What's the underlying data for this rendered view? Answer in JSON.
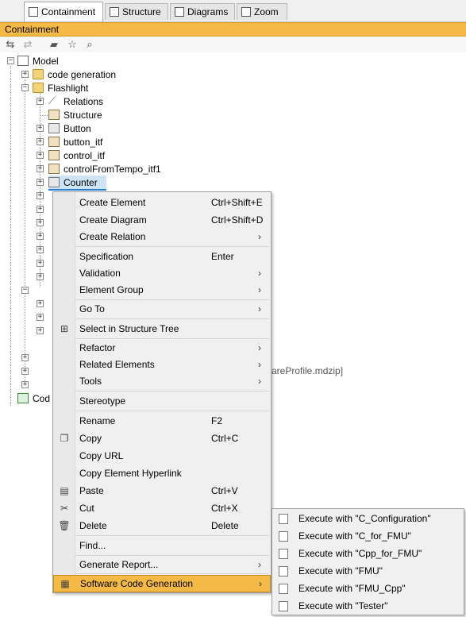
{
  "tabs": [
    {
      "label": "Containment",
      "icon": "containment-icon",
      "active": true
    },
    {
      "label": "Structure",
      "icon": "structure-icon",
      "active": false
    },
    {
      "label": "Diagrams",
      "icon": "diagrams-icon",
      "active": false
    },
    {
      "label": "Zoom",
      "icon": "zoom-icon",
      "active": false
    }
  ],
  "panel": {
    "title": "Containment"
  },
  "toolbar": {
    "icons": [
      "collapse-all-icon",
      "expand-icon",
      "open-folder-icon",
      "star-icon",
      "search-icon"
    ]
  },
  "tree": {
    "model": "Model",
    "code_generation": "code generation",
    "flashlight": "Flashlight",
    "relations": "Relations",
    "structure": "Structure",
    "button": "Button",
    "button_itf": "button_itf",
    "control_itf": "control_itf",
    "control_from_tempo": "controlFromTempo_itf1",
    "counter": "Counter",
    "profile_suffix": "areProfile.mdzip]",
    "code_partial": "Cod"
  },
  "context_menu": {
    "items": [
      {
        "label": "Create Element",
        "shortcut": "Ctrl+Shift+E"
      },
      {
        "label": "Create Diagram",
        "shortcut": "Ctrl+Shift+D"
      },
      {
        "label": "Create Relation",
        "submenu": true
      },
      {
        "label": "Specification",
        "shortcut": "Enter"
      },
      {
        "label": "Validation",
        "submenu": true
      },
      {
        "label": "Element Group",
        "submenu": true
      },
      {
        "label": "Go To",
        "submenu": true
      },
      {
        "label": "Select in Structure Tree",
        "icon": "structure-tree-icon"
      },
      {
        "label": "Refactor",
        "submenu": true
      },
      {
        "label": "Related Elements",
        "submenu": true
      },
      {
        "label": "Tools",
        "submenu": true
      },
      {
        "label": "Stereotype"
      },
      {
        "label": "Rename",
        "shortcut": "F2"
      },
      {
        "label": "Copy",
        "shortcut": "Ctrl+C",
        "icon": "copy-icon"
      },
      {
        "label": "Copy URL"
      },
      {
        "label": "Copy Element Hyperlink"
      },
      {
        "label": "Paste",
        "shortcut": "Ctrl+V",
        "icon": "paste-icon"
      },
      {
        "label": "Cut",
        "shortcut": "Ctrl+X",
        "icon": "cut-icon"
      },
      {
        "label": "Delete",
        "shortcut": "Delete",
        "icon": "delete-icon"
      },
      {
        "label": "Find..."
      },
      {
        "label": "Generate Report...",
        "submenu": true
      },
      {
        "label": "Software Code Generation",
        "submenu": true,
        "highlighted": true,
        "icon": "code-generation-icon"
      }
    ],
    "arrow": "›"
  },
  "submenu": {
    "items": [
      "Execute with \"C_Configuration\"",
      "Execute with \"C_for_FMU\"",
      "Execute with \"Cpp_for_FMU\"",
      "Execute with \"FMU\"",
      "Execute with \"FMU_Cpp\"",
      "Execute with \"Tester\""
    ]
  },
  "colors": {
    "accent": "#f5b946",
    "selection": "#cde4f7",
    "selection_border": "#2a7fd4"
  }
}
